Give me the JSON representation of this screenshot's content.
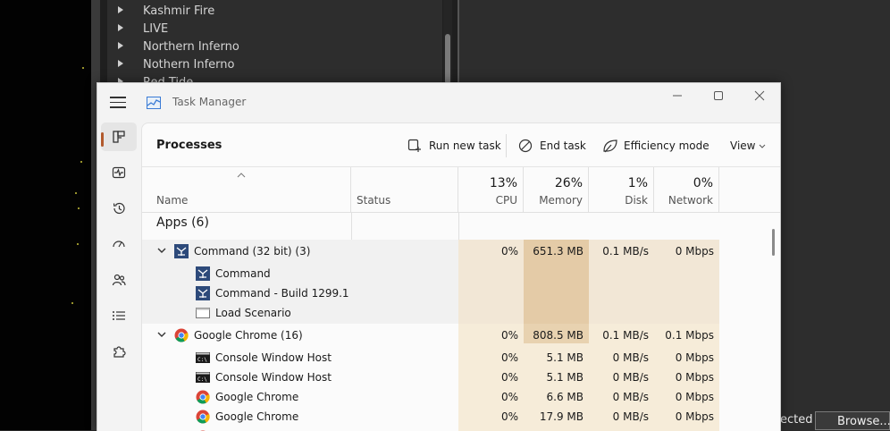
{
  "background": {
    "tree_items": [
      "Kashmir Fire",
      "LIVE",
      "Northern Inferno",
      "Nothern Inferno",
      "Red Tide"
    ],
    "status_text": "ected",
    "browse_label": "Browse..."
  },
  "window": {
    "title": "Task Manager",
    "controls": [
      "minimize-icon",
      "maximize-icon",
      "close-icon"
    ]
  },
  "nav": {
    "items": [
      "Processes",
      "Performance",
      "App history",
      "Startup apps",
      "Users",
      "Details",
      "Services"
    ],
    "active": "Processes"
  },
  "toolbar": {
    "title": "Processes",
    "run_new_task": "Run new task",
    "end_task": "End task",
    "efficiency_mode": "Efficiency mode",
    "view": "View"
  },
  "header": {
    "name": "Name",
    "status": "Status",
    "cpu_pct": "13%",
    "cpu": "CPU",
    "memory_pct": "26%",
    "memory": "Memory",
    "disk_pct": "1%",
    "disk": "Disk",
    "network_pct": "0%",
    "network": "Network"
  },
  "groups": {
    "apps": "Apps (6)"
  },
  "rows": [
    {
      "name": "Command (32 bit) (3)",
      "cpu": "0%",
      "memory": "651.3 MB",
      "disk": "0.1 MB/s",
      "network": "0 Mbps"
    },
    {
      "name": "Command"
    },
    {
      "name": "Command - Build 1299.1"
    },
    {
      "name": "Load Scenario"
    },
    {
      "name": "Google Chrome (16)",
      "cpu": "0%",
      "memory": "808.5 MB",
      "disk": "0.1 MB/s",
      "network": "0.1 Mbps"
    },
    {
      "name": "Console Window Host",
      "cpu": "0%",
      "memory": "5.1 MB",
      "disk": "0 MB/s",
      "network": "0 Mbps"
    },
    {
      "name": "Console Window Host",
      "cpu": "0%",
      "memory": "5.1 MB",
      "disk": "0 MB/s",
      "network": "0 Mbps"
    },
    {
      "name": "Google Chrome",
      "cpu": "0%",
      "memory": "6.6 MB",
      "disk": "0 MB/s",
      "network": "0 Mbps"
    },
    {
      "name": "Google Chrome",
      "cpu": "0%",
      "memory": "17.9 MB",
      "disk": "0 MB/s",
      "network": "0 Mbps"
    }
  ],
  "colors": {
    "heat_light": "#f6ecd9",
    "heat_mid": "#eedfc6",
    "heat_dark": "#e4cba7",
    "accent": "#b25a2d"
  }
}
